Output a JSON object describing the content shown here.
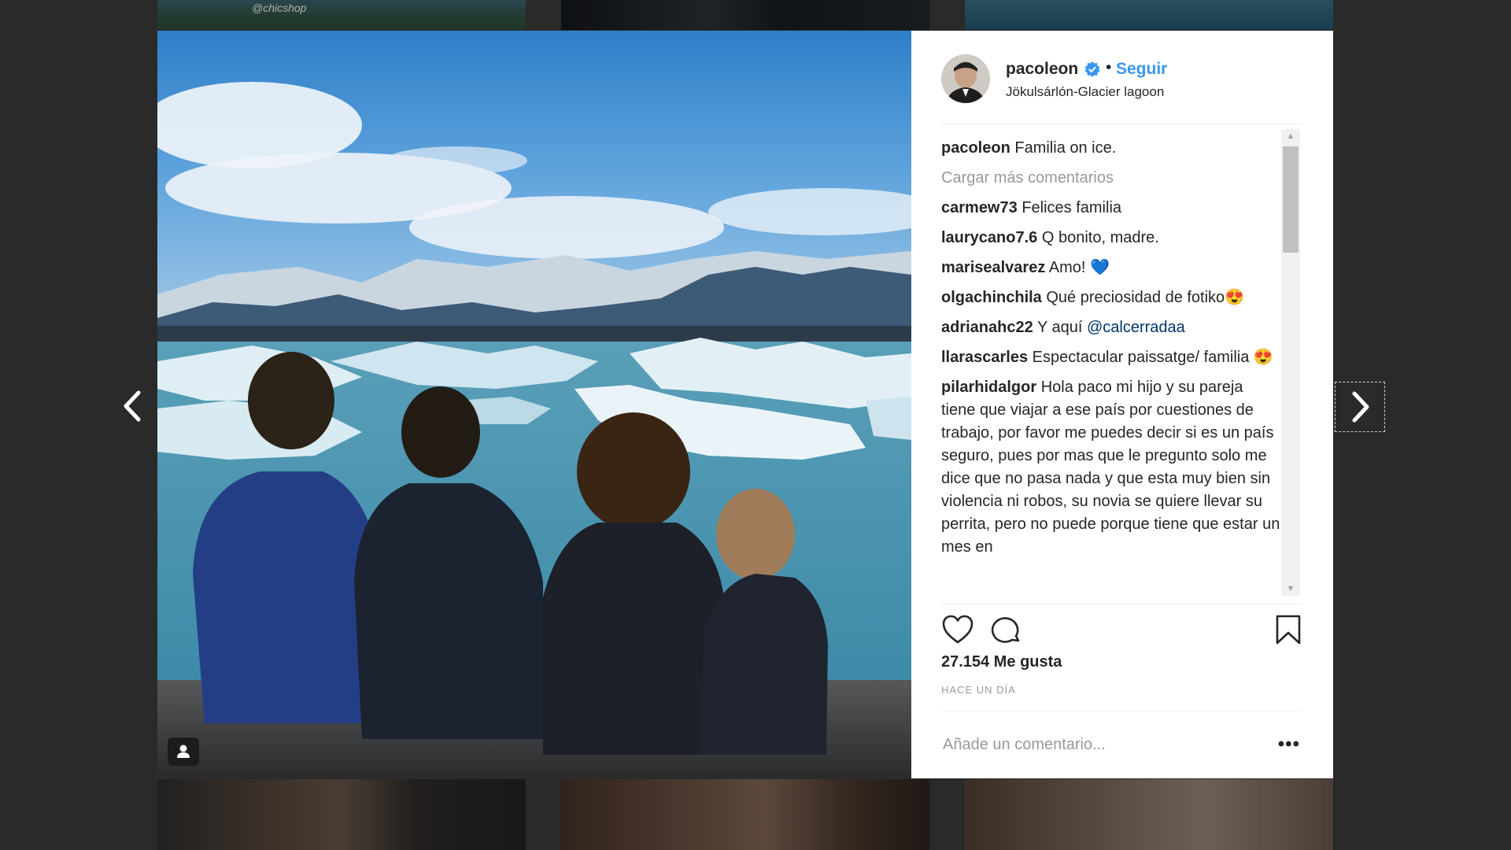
{
  "background": {
    "top_left_caption": "@chicshop"
  },
  "post": {
    "username": "pacoleon",
    "follow_label": "Seguir",
    "separator": "•",
    "location": "Jökulsárlón-Glacier lagoon",
    "caption_user": "pacoleon",
    "caption_text": "Familia on ice.",
    "load_more": "Cargar más comentarios",
    "comments": [
      {
        "user": "carmew73",
        "text": "Felices familia"
      },
      {
        "user": "laurycano7.6",
        "text": "Q bonito, madre."
      },
      {
        "user": "marisealvarez",
        "text": "Amo! 💙"
      },
      {
        "user": "olgachinchila",
        "text": "Qué preciosidad de fotiko😍"
      },
      {
        "user": "adrianahc22",
        "text": "Y aquí",
        "mention": "@calcerradaa"
      },
      {
        "user": "llarascarles",
        "text": "Espectacular paissatge/ familia 😍"
      },
      {
        "user": "pilarhidalgor",
        "text": "Hola paco mi hijo y su pareja tiene que viajar a ese país por cuestiones de trabajo, por favor me puedes decir si es un país seguro, pues por mas que le pregunto solo me dice que no pasa nada y que esta muy bien sin violencia ni robos, su novia se quiere llevar su perrita, pero no puede porque tiene que estar un mes en"
      }
    ],
    "likes": "27.154 Me gusta",
    "time": "HACE UN DÍA",
    "add_comment_placeholder": "Añade un comentario...",
    "more_label": "•••"
  },
  "icons": {
    "prev": "chevron-left-icon",
    "next": "chevron-right-icon",
    "verified": "verified-badge-icon",
    "like": "heart-icon",
    "comment": "comment-icon",
    "save": "bookmark-icon",
    "tagged": "user-tag-icon"
  },
  "colors": {
    "link": "#3897f0",
    "text": "#262626",
    "muted": "#999999",
    "verified": "#3897f0"
  }
}
